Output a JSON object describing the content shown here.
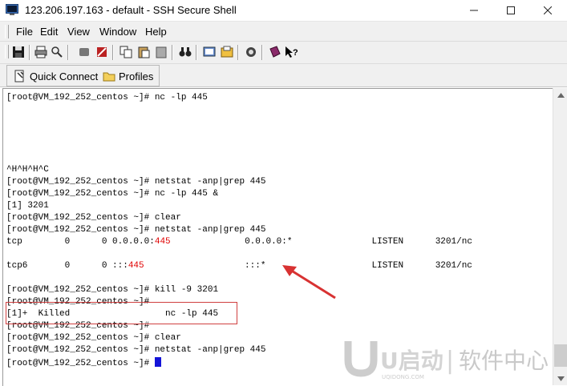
{
  "window": {
    "title": "123.206.197.163 - default - SSH Secure Shell",
    "controls": [
      "minimize",
      "maximize",
      "close"
    ]
  },
  "menu": [
    "File",
    "Edit",
    "View",
    "Window",
    "Help"
  ],
  "toolbar": {
    "icons": [
      "save-icon",
      "print-icon",
      "find-icon",
      "disconnect-icon",
      "settings-icon",
      "copy-icon",
      "paste-icon",
      "paste-alt-icon",
      "binoculars-icon",
      "new-terminal-icon",
      "new-file-transfer-icon",
      "key-icon",
      "help-book-icon",
      "whats-this-icon"
    ]
  },
  "profilebar": {
    "quick_connect": "Quick Connect",
    "profiles": "Profiles"
  },
  "terminal": {
    "lines": [
      "[root@VM_192_252_centos ~]# nc -lp 445",
      "",
      "",
      "",
      "",
      "",
      "^H^H^H^C",
      "[root@VM_192_252_centos ~]# netstat -anp|grep 445",
      "[root@VM_192_252_centos ~]# nc -lp 445 &",
      "[1] 3201",
      "[root@VM_192_252_centos ~]# clear",
      "[root@VM_192_252_centos ~]# netstat -anp|grep 445",
      {
        "pre": "tcp        0      0 0.0.0.0:",
        "red": "445",
        "post": "              0.0.0.0:*               LISTEN      3201/nc"
      },
      "",
      {
        "pre": "tcp6       0      0 :::",
        "red": "445",
        "post": "                   :::*                    LISTEN      3201/nc"
      },
      "",
      "[root@VM_192_252_centos ~]# kill -9 3201",
      "[root@VM_192_252_centos ~]#",
      "[1]+  Killed                  nc -lp 445",
      "[root@VM_192_252_centos ~]#",
      "[root@VM_192_252_centos ~]# clear",
      "[root@VM_192_252_centos ~]# netstat -anp|grep 445",
      "[root@VM_192_252_centos ~]# "
    ]
  },
  "watermark": {
    "brand": "U启动",
    "divider": "|",
    "label": "软件中心",
    "sub": "UQIDONG.COM"
  },
  "colors": {
    "accent_red": "#e00000",
    "cursor_blue": "#1414d8",
    "annotation_red": "#d04040"
  }
}
